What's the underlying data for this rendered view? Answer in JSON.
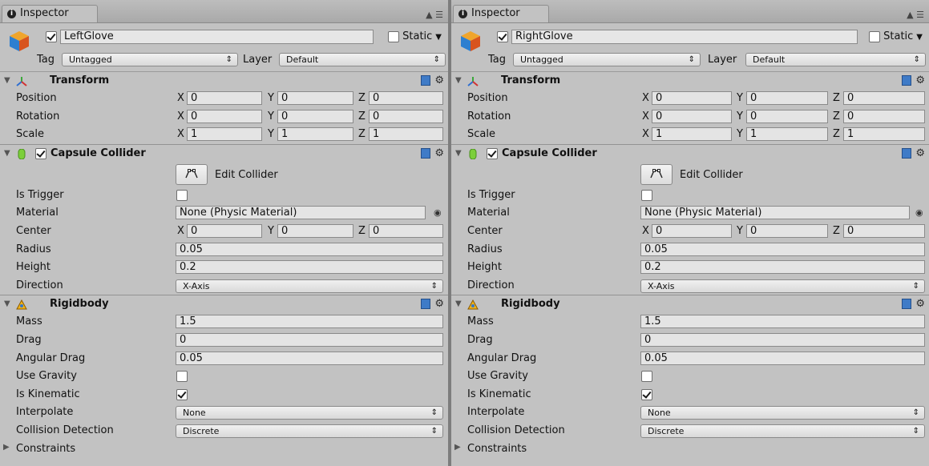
{
  "tab_title": "Inspector",
  "tab_tools": "▲ ☰",
  "panels": [
    {
      "object_name": "LeftGlove",
      "active": true,
      "static_label": "Static",
      "tag_label": "Tag",
      "tag_value": "Untagged",
      "layer_label": "Layer",
      "layer_value": "Default",
      "transform": {
        "title": "Transform",
        "position_label": "Position",
        "rotation_label": "Rotation",
        "scale_label": "Scale",
        "position": {
          "x": "0",
          "y": "0",
          "z": "0"
        },
        "rotation": {
          "x": "0",
          "y": "0",
          "z": "0"
        },
        "scale": {
          "x": "1",
          "y": "1",
          "z": "1"
        }
      },
      "capsule": {
        "title": "Capsule Collider",
        "enabled": true,
        "edit_label": "Edit Collider",
        "is_trigger_label": "Is Trigger",
        "is_trigger": false,
        "material_label": "Material",
        "material": "None (Physic Material)",
        "center_label": "Center",
        "center": {
          "x": "0",
          "y": "0",
          "z": "0"
        },
        "radius_label": "Radius",
        "radius": "0.05",
        "height_label": "Height",
        "height": "0.2",
        "direction_label": "Direction",
        "direction": "X-Axis"
      },
      "rigidbody": {
        "title": "Rigidbody",
        "mass_label": "Mass",
        "mass": "1.5",
        "drag_label": "Drag",
        "drag": "0",
        "angular_drag_label": "Angular Drag",
        "angular_drag": "0.05",
        "use_gravity_label": "Use Gravity",
        "use_gravity": false,
        "is_kinematic_label": "Is Kinematic",
        "is_kinematic": true,
        "interpolate_label": "Interpolate",
        "interpolate": "None",
        "collision_label": "Collision Detection",
        "collision": "Discrete",
        "constraints_label": "Constraints"
      }
    },
    {
      "object_name": "RightGlove",
      "active": true,
      "static_label": "Static",
      "tag_label": "Tag",
      "tag_value": "Untagged",
      "layer_label": "Layer",
      "layer_value": "Default",
      "transform": {
        "title": "Transform",
        "position_label": "Position",
        "rotation_label": "Rotation",
        "scale_label": "Scale",
        "position": {
          "x": "0",
          "y": "0",
          "z": "0"
        },
        "rotation": {
          "x": "0",
          "y": "0",
          "z": "0"
        },
        "scale": {
          "x": "1",
          "y": "1",
          "z": "1"
        }
      },
      "capsule": {
        "title": "Capsule Collider",
        "enabled": true,
        "edit_label": "Edit Collider",
        "is_trigger_label": "Is Trigger",
        "is_trigger": false,
        "material_label": "Material",
        "material": "None (Physic Material)",
        "center_label": "Center",
        "center": {
          "x": "0",
          "y": "0",
          "z": "0"
        },
        "radius_label": "Radius",
        "radius": "0.05",
        "height_label": "Height",
        "height": "0.2",
        "direction_label": "Direction",
        "direction": "X-Axis"
      },
      "rigidbody": {
        "title": "Rigidbody",
        "mass_label": "Mass",
        "mass": "1.5",
        "drag_label": "Drag",
        "drag": "0",
        "angular_drag_label": "Angular Drag",
        "angular_drag": "0.05",
        "use_gravity_label": "Use Gravity",
        "use_gravity": false,
        "is_kinematic_label": "Is Kinematic",
        "is_kinematic": true,
        "interpolate_label": "Interpolate",
        "interpolate": "None",
        "collision_label": "Collision Detection",
        "collision": "Discrete",
        "constraints_label": "Constraints"
      }
    }
  ],
  "axis_labels": {
    "x": "X",
    "y": "Y",
    "z": "Z"
  },
  "icons": {
    "tab": "info-icon",
    "object": "cube-icon",
    "transform": "transform-axes-icon",
    "capsule": "capsule-icon",
    "rigidbody": "rigidbody-icon",
    "help": "help-book-icon",
    "settings": "gear-icon",
    "edit": "edit-collider-icon",
    "picker": "object-picker-icon"
  },
  "colors": {
    "panel_bg": "#c2c2c2",
    "field_bg": "#e4e4e4",
    "accent_blue": "#3f7bc7"
  }
}
